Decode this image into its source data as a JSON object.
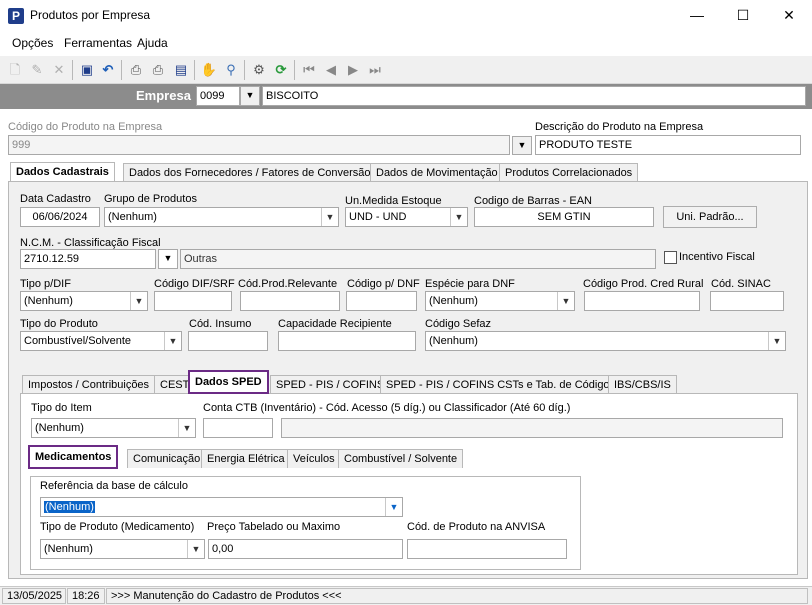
{
  "window": {
    "title": "Produtos por Empresa",
    "app_icon_letter": "P",
    "minimize": "—",
    "maximize": "☐",
    "close": "✕"
  },
  "menu": {
    "items": [
      "Opções",
      "Ferramentas",
      "Ajuda"
    ]
  },
  "toolbar": {
    "icons": [
      "new-icon",
      "edit-icon",
      "delete-icon",
      "save-icon",
      "undo-icon",
      "print-icon",
      "print-preview-icon",
      "export-icon",
      "hand-icon",
      "search-icon",
      "settings-icon",
      "refresh-icon",
      "first-record-icon",
      "previous-record-icon",
      "next-record-icon",
      "last-record-icon"
    ]
  },
  "empresa": {
    "label": "Empresa",
    "code": "0099",
    "name": "BISCOITO"
  },
  "produto": {
    "codigo_label": "Código do Produto na Empresa",
    "codigo_value": "999",
    "descricao_label": "Descrição do Produto na Empresa",
    "descricao_value": "PRODUTO TESTE"
  },
  "main_tabs": [
    "Dados Cadastrais",
    "Dados dos Fornecedores / Fatores de Conversão",
    "Dados de Movimentação",
    "Produtos Correlacionados"
  ],
  "cadastro": {
    "data_cadastro_label": "Data Cadastro",
    "data_cadastro_value": "06/06/2024",
    "grupo_label": "Grupo de Produtos",
    "grupo_value": "(Nenhum)",
    "unidade_label": "Un.Medida Estoque",
    "unidade_value": "UND - UND",
    "ean_label": "Codigo de Barras - EAN",
    "ean_value": "SEM GTIN",
    "un_padrao_button": "Uni. Padrão...",
    "ncm_label": "N.C.M. -  Classificação Fiscal",
    "ncm_value": "2710.12.59",
    "ncm_desc": "Outras",
    "incentivo_label": "Incentivo Fiscal",
    "tipo_dif_label": "Tipo p/DIF",
    "tipo_dif_value": "(Nenhum)",
    "codigo_dif_label": "Código DIF/SRF",
    "cod_relevante_label": "Cód.Prod.Relevante",
    "codigo_dnf_label": "Código p/ DNF",
    "especie_dnf_label": "Espécie para DNF",
    "especie_dnf_value": "(Nenhum)",
    "cred_rural_label": "Código Prod. Cred Rural",
    "sinac_label": "Cód. SINAC",
    "tipo_produto_label": "Tipo do Produto",
    "tipo_produto_value": "Combustível/Solvente",
    "insumo_label": "Cód. Insumo",
    "capacidade_label": "Capacidade Recipiente",
    "sefaz_label": "Código Sefaz",
    "sefaz_value": "(Nenhum)"
  },
  "sub_tabs": [
    "Impostos / Contribuições",
    "CEST",
    "Dados SPED",
    "SPED - PIS / COFINS",
    "SPED - PIS / COFINS CSTs e Tab. de Códigos",
    "IBS/CBS/IS"
  ],
  "sped": {
    "tipo_item_label": "Tipo do Item",
    "tipo_item_value": "(Nenhum)",
    "conta_ctb_label": "Conta CTB (Inventário) - Cód. Acesso (5 díg.) ou Classificador (Até 60 díg.)"
  },
  "sped_tabs": [
    "Medicamentos",
    "Comunicação",
    "Energia Elétrica",
    "Veículos",
    "Combustível / Solvente"
  ],
  "medicamentos": {
    "referencia_label": "Referência da base de cálculo",
    "referencia_value": "(Nenhum)",
    "tipo_label": "Tipo de Produto (Medicamento)",
    "tipo_value": "(Nenhum)",
    "preco_label": "Preço Tabelado ou Maximo",
    "preco_value": "0,00",
    "anvisa_label": "Cód. de Produto na ANVISA"
  },
  "status": {
    "date": "13/05/2025",
    "time": "18:26",
    "message": ">>> Manutenção do Cadastro de Produtos <<<"
  },
  "colors": {
    "highlight": "#6b2a85",
    "empresa_bar": "#8c8c8c",
    "selection": "#0a64c8"
  }
}
